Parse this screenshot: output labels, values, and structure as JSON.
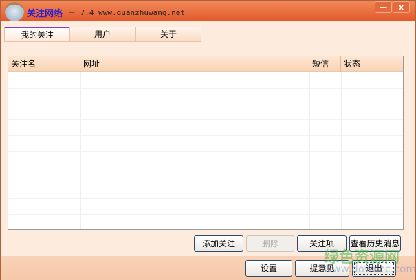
{
  "window": {
    "app_name": "关注网络",
    "version_text": "－ 7.4 www.guanzhuwang.net",
    "minimize": "—",
    "close": "x"
  },
  "tabs": [
    {
      "label": "我的关注"
    },
    {
      "label": "用户"
    },
    {
      "label": "关于"
    }
  ],
  "list": {
    "columns": [
      "关注名",
      "网址",
      "短信",
      "状态"
    ],
    "rows": []
  },
  "buttons": {
    "add": "添加关注",
    "delete": "删除",
    "items": "关注项",
    "history": "查看历史消息",
    "settings": "设置",
    "feedback": "提意见",
    "exit": "退出"
  },
  "watermark": {
    "line1": "绿色资源网",
    "line2": "www.downcc.com"
  }
}
